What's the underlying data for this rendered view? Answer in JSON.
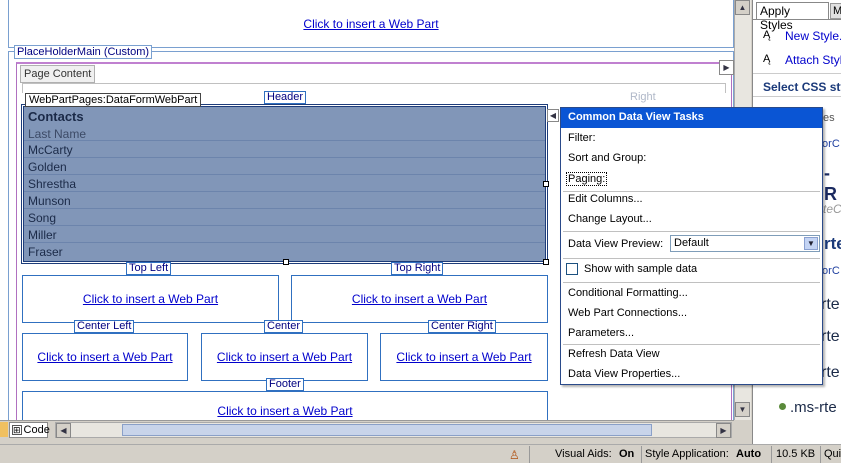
{
  "top_zone": {
    "link": "Click to insert a Web Part"
  },
  "placeholder": {
    "label": "PlaceHolderMain (Custom)"
  },
  "page_content": {
    "tab_label": "Page Content"
  },
  "header_zone": {
    "label": "Header",
    "right_label": "Right"
  },
  "dataform": {
    "label": "WebPartPages:DataFormWebPart",
    "title": "Contacts",
    "column": "Last Name",
    "rows": [
      "McCarty",
      "Golden",
      "Shrestha",
      "Munson",
      "Song",
      "Miller",
      "Fraser"
    ]
  },
  "zones": {
    "top_left": {
      "label": "Top Left",
      "link": "Click to insert a Web Part"
    },
    "top_right": {
      "label": "Top Right",
      "link": "Click to insert a Web Part"
    },
    "center_left": {
      "label": "Center Left",
      "link": "Click to insert a Web Part"
    },
    "center": {
      "label": "Center",
      "link": "Click to insert a Web Part"
    },
    "center_right": {
      "label": "Center Right",
      "link": "Click to insert a Web Part"
    },
    "footer": {
      "label": "Footer",
      "link": "Click to insert a Web Part"
    }
  },
  "menu": {
    "title": "Common Data View Tasks",
    "filter": "Filter:",
    "sort_group": "Sort and Group:",
    "paging": "Paging:",
    "edit_columns": "Edit Columns...",
    "change_layout": "Change Layout...",
    "preview_label": "Data View Preview:",
    "preview_value": "Default",
    "sample_data": "Show with sample data",
    "conditional_formatting": "Conditional Formatting...",
    "web_part_connections": "Web Part Connections...",
    "parameters": "Parameters...",
    "refresh": "Refresh Data View",
    "properties": "Data View Properties..."
  },
  "bottom": {
    "code_tab": "Code"
  },
  "status": {
    "visual_aids_label": "Visual Aids:",
    "visual_aids_value": "On",
    "style_app_label": "Style Application:",
    "style_app_value": "Auto",
    "size": "10.5 KB",
    "trunc": "Qui"
  },
  "right_panel": {
    "tab": "Apply Styles",
    "tab2": "M",
    "new_style": "New Style...",
    "attach_style": "Attach Style",
    "select_css": "Select CSS sty",
    "frag1": "es",
    "frag2": "torC",
    "frag3": "-R",
    "frag4": "teC",
    "frag5": "rte",
    "frag6": "torC",
    "frag7": "rte",
    "frag8": "rte",
    "frag9": "rte",
    "ms_rte": ".ms-rte"
  },
  "colors": {
    "menu_title_bg": "#0a55d4",
    "grid_bg": "#8196b8",
    "zone_border": "#3070c0"
  }
}
